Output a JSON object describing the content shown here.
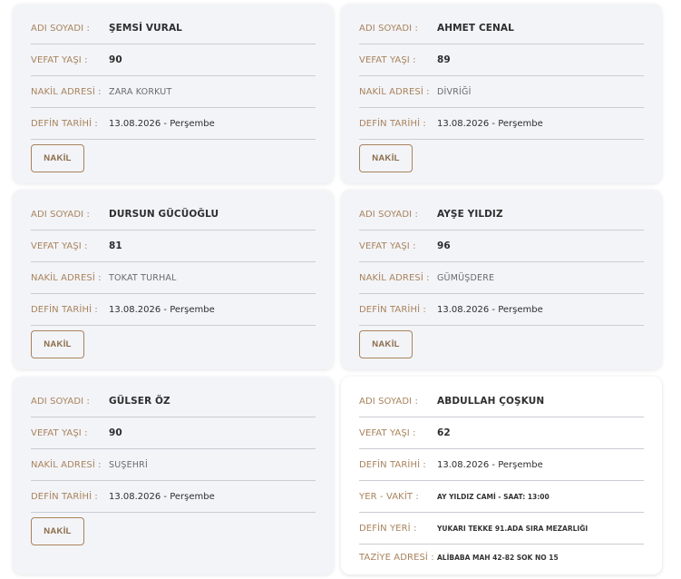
{
  "labels": {
    "name": "ADI SOYADI :",
    "age": "VEFAT YAŞI :",
    "address": "NAKİL ADRESİ :",
    "date": "DEFİN TARİHİ :",
    "place_time": "YER - VAKİT :",
    "burial_place": "DEFİN YERİ :",
    "condolence": "TAZİYE ADRESİ :"
  },
  "button_label": "NAKİL",
  "cards": [
    {
      "name": "ŞEMSİ VURAL",
      "age": "90",
      "address": "ZARA KORKUT",
      "date": "13.08.2026 - Perşembe"
    },
    {
      "name": "AHMET CENAL",
      "age": "89",
      "address": "DİVRİĞİ",
      "date": "13.08.2026 - Perşembe"
    },
    {
      "name": "DURSUN GÜCÜOĞLU",
      "age": "81",
      "address": "TOKAT TURHAL",
      "date": "13.08.2026 - Perşembe"
    },
    {
      "name": "AYŞE YILDIZ",
      "age": "96",
      "address": "GÜMÜŞDERE",
      "date": "13.08.2026 - Perşembe"
    },
    {
      "name": "GÜLSER ÖZ",
      "age": "90",
      "address": "SUŞEHRİ",
      "date": "13.08.2026 - Perşembe"
    }
  ],
  "detail_card": {
    "name": "ABDULLAH ÇOŞKUN",
    "age": "62",
    "date": "13.08.2026 - Perşembe",
    "place_time": "AY YILDIZ CAMİ - SAAT: 13:00",
    "burial_place": "YUKARI TEKKE 91.ADA SIRA MEZARLIĞI",
    "condolence": "ALİBABA MAH 42-82 SOK NO 15"
  },
  "colors": {
    "label": "#a8835c",
    "card_bg": "#f3f4f8",
    "divider": "#c9ccd3"
  }
}
